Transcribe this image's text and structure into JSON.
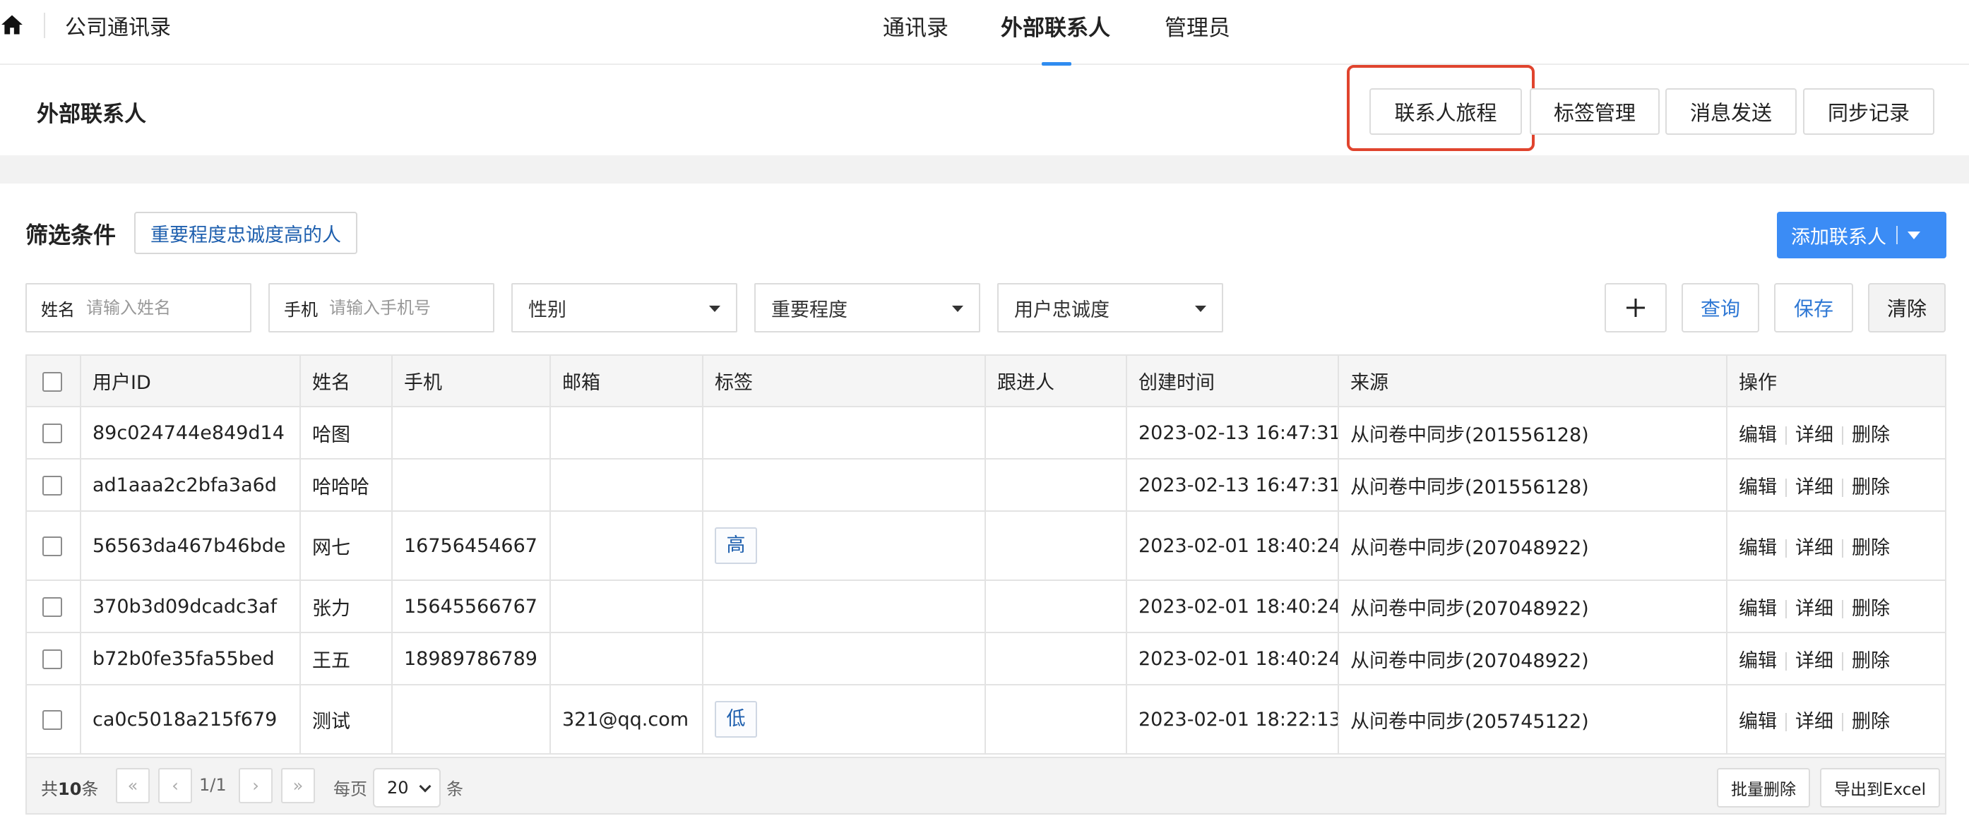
{
  "app": {
    "title": "公司通讯录"
  },
  "nav": {
    "tabs": [
      "通讯录",
      "外部联系人",
      "管理员"
    ],
    "active_tab": "外部联系人"
  },
  "header": {
    "title": "外部联系人",
    "buttons": [
      "联系人旅程",
      "标签管理",
      "消息发送",
      "同步记录"
    ],
    "highlighted_button": "联系人旅程"
  },
  "filters": {
    "title": "筛选条件",
    "preset": "重要程度忠诚度高的人",
    "name_label": "姓名",
    "name_placeholder": "请输入姓名",
    "phone_label": "手机",
    "phone_placeholder": "请输入手机号",
    "gender": "性别",
    "importance": "重要程度",
    "loyalty": "用户忠诚度",
    "add_icon": "plus-icon",
    "query_label": "查询",
    "save_label": "保存",
    "clear_label": "清除",
    "add_contact_label": "添加联系人"
  },
  "table": {
    "headers": [
      "用户ID",
      "姓名",
      "手机",
      "邮箱",
      "标签",
      "跟进人",
      "创建时间",
      "来源",
      "操作"
    ],
    "rows": [
      {
        "id": "89c024744e849d14",
        "name": "哈图",
        "phone": "",
        "email": "",
        "tag": "",
        "follower": "",
        "created": "2023-02-13 16:47:31",
        "source": "从问卷中同步(201556128)"
      },
      {
        "id": "ad1aaa2c2bfa3a6d",
        "name": "哈哈哈",
        "phone": "",
        "email": "",
        "tag": "",
        "follower": "",
        "created": "2023-02-13 16:47:31",
        "source": "从问卷中同步(201556128)"
      },
      {
        "id": "56563da467b46bde",
        "name": "网七",
        "phone": "16756454667",
        "email": "",
        "tag": "高",
        "follower": "",
        "created": "2023-02-01 18:40:24",
        "source": "从问卷中同步(207048922)"
      },
      {
        "id": "370b3d09dcadc3af",
        "name": "张力",
        "phone": "15645566767",
        "email": "",
        "tag": "",
        "follower": "",
        "created": "2023-02-01 18:40:24",
        "source": "从问卷中同步(207048922)"
      },
      {
        "id": "b72b0fe35fa55bed",
        "name": "王五",
        "phone": "18989786789",
        "email": "",
        "tag": "",
        "follower": "",
        "created": "2023-02-01 18:40:24",
        "source": "从问卷中同步(207048922)"
      },
      {
        "id": "ca0c5018a215f679",
        "name": "测试",
        "phone": "",
        "email": "321@qq.com",
        "tag": "低",
        "follower": "",
        "created": "2023-02-01 18:22:13",
        "source": "从问卷中同步(205745122)"
      }
    ],
    "row_actions": [
      "编辑",
      "详细",
      "删除"
    ]
  },
  "footer": {
    "total_prefix": "共",
    "total_count": "10",
    "total_suffix": "条",
    "page_info": "1/1",
    "per_page_label": "每页",
    "page_size": "20",
    "unit": "条",
    "batch_delete": "批量删除",
    "export": "导出到Excel"
  },
  "colors": {
    "primary": "#3b8cf5",
    "highlight": "#e0442e",
    "link": "#1e5fae"
  }
}
